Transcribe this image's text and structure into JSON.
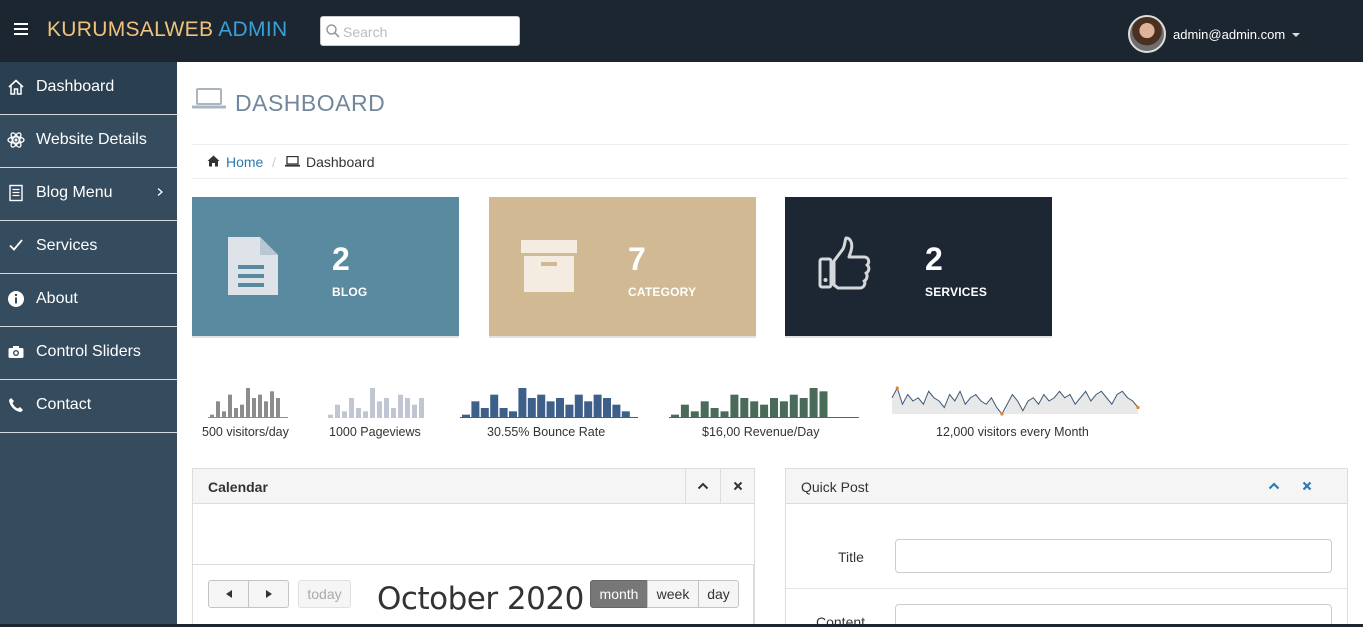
{
  "brand": {
    "part1": "KURUMSALWEB",
    "part2": "ADMIN"
  },
  "search": {
    "placeholder": "Search",
    "value": ""
  },
  "user": {
    "email": "admin@admin.com"
  },
  "sidebar": {
    "items": [
      {
        "label": "Dashboard",
        "icon": "home-icon",
        "active": true
      },
      {
        "label": "Website Details",
        "icon": "atom-icon"
      },
      {
        "label": "Blog Menu",
        "icon": "document-icon",
        "has_submenu": true
      },
      {
        "label": "Services",
        "icon": "check-icon"
      },
      {
        "label": "About",
        "icon": "info-circle-icon"
      },
      {
        "label": "Control Sliders",
        "icon": "camera-icon"
      },
      {
        "label": "Contact",
        "icon": "phone-icon"
      }
    ]
  },
  "page": {
    "title": "DASHBOARD"
  },
  "breadcrumb": {
    "home": "Home",
    "current": "Dashboard"
  },
  "tiles": [
    {
      "count": "2",
      "label": "BLOG",
      "icon": "file-text-icon",
      "color": "#5a8aa0"
    },
    {
      "count": "7",
      "label": "CATEGORY",
      "icon": "archive-box-icon",
      "color": "#d1b994"
    },
    {
      "count": "2",
      "label": "SERVICES",
      "icon": "thumbs-up-icon",
      "color": "#1c2733"
    }
  ],
  "stats": [
    {
      "label": "500 visitors/day",
      "values": [
        1,
        5,
        2,
        7,
        3,
        4,
        9,
        6,
        7,
        5,
        8,
        6
      ],
      "color": "#8c8c8c"
    },
    {
      "label": "1000 Pageviews",
      "values": [
        1,
        4,
        2,
        6,
        3,
        2,
        9,
        5,
        6,
        3,
        7,
        6,
        4,
        6
      ],
      "color": "#c0c7d2"
    },
    {
      "label": "30.55% Bounce Rate",
      "values": [
        1,
        5,
        3,
        7,
        3,
        2,
        9,
        6,
        7,
        5,
        6,
        4,
        7,
        5,
        7,
        6,
        4,
        2
      ],
      "color": "#3d5f8a"
    },
    {
      "label": "$16,00 Revenue/Day",
      "values": [
        1,
        4,
        2,
        5,
        3,
        2,
        7,
        6,
        5,
        4,
        6,
        5,
        7,
        6,
        9,
        8
      ],
      "color": "#4a6b5a"
    },
    {
      "label": "12,000 visitors every Month",
      "values": [
        6,
        9,
        4,
        7,
        5,
        6,
        4,
        8,
        6,
        5,
        3,
        7,
        5,
        8,
        4,
        6,
        7,
        5,
        4,
        6,
        3,
        1,
        4,
        7,
        5,
        2,
        5,
        6,
        4,
        7,
        5,
        6,
        8,
        6,
        7,
        4,
        6,
        8,
        5,
        7,
        8,
        6,
        4,
        7,
        8,
        6,
        5,
        3
      ],
      "color": "#3e5875",
      "fill": "#e8e8e8"
    }
  ],
  "calendar": {
    "title": "Calendar",
    "month_title": "October 2020",
    "today": "today",
    "views": [
      "month",
      "week",
      "day"
    ],
    "selected_view": "month"
  },
  "quick_post": {
    "title": "Quick Post",
    "fields": [
      {
        "label": "Title"
      },
      {
        "label": "Content"
      }
    ]
  },
  "colors": {
    "topbar": "#1b2631",
    "sidebar": "#354b5e",
    "accent": "#2a7ab0"
  }
}
